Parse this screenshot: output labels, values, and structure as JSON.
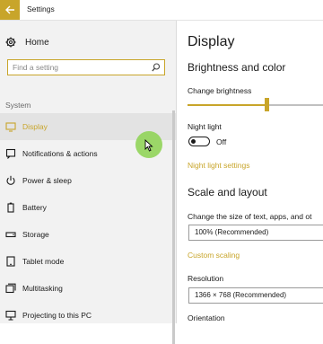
{
  "window": {
    "title": "Settings"
  },
  "colors": {
    "accent": "#c8a52a",
    "sidebar_bg": "#f2f2f2",
    "active_item_bg": "#e3e3e3"
  },
  "sidebar": {
    "home_label": "Home",
    "search_placeholder": "Find a setting",
    "section_label": "System",
    "items": [
      {
        "label": "Display",
        "icon": "monitor-icon",
        "active": true
      },
      {
        "label": "Notifications & actions",
        "icon": "notifications-icon"
      },
      {
        "label": "Power & sleep",
        "icon": "power-icon"
      },
      {
        "label": "Battery",
        "icon": "battery-icon"
      },
      {
        "label": "Storage",
        "icon": "storage-icon"
      },
      {
        "label": "Tablet mode",
        "icon": "tablet-icon"
      },
      {
        "label": "Multitasking",
        "icon": "multitasking-icon"
      },
      {
        "label": "Projecting to this PC",
        "icon": "projecting-icon"
      }
    ]
  },
  "main": {
    "title": "Display",
    "brightness_heading": "Brightness and color",
    "brightness_label": "Change brightness",
    "brightness_fraction": 0.55,
    "night_light_label": "Night light",
    "night_light_state": "Off",
    "night_light_settings_link": "Night light settings",
    "scale_heading": "Scale and layout",
    "scale_label": "Change the size of text, apps, and ot",
    "scale_value": "100% (Recommended)",
    "custom_scaling_link": "Custom scaling",
    "resolution_label": "Resolution",
    "resolution_value": "1366 × 768 (Recommended)",
    "orientation_label": "Orientation"
  }
}
